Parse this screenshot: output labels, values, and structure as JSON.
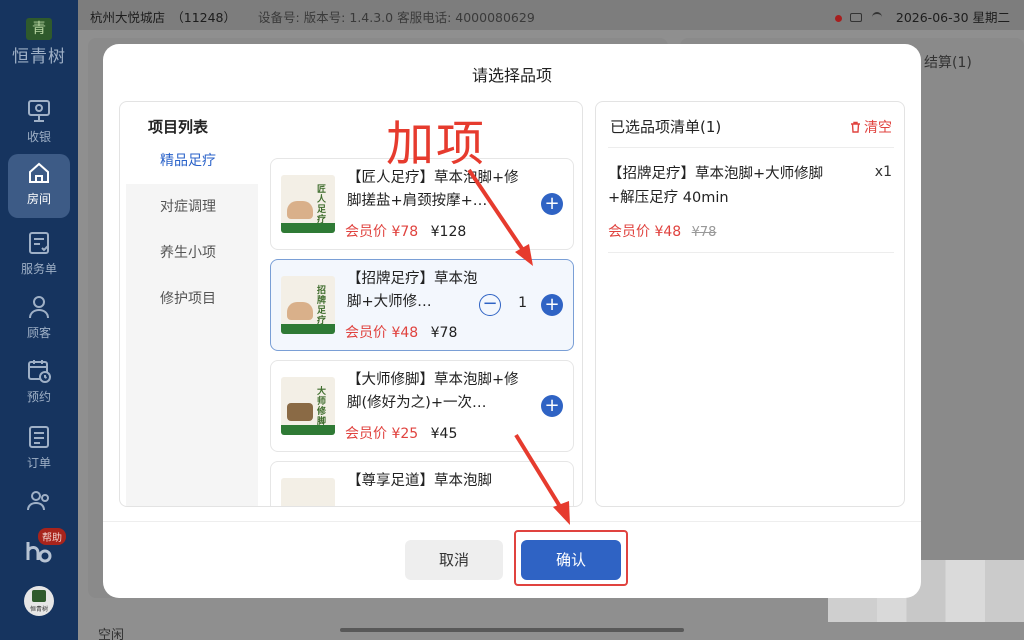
{
  "app": {
    "brand_glyph": "青",
    "brand_name": "恒青树",
    "nav": [
      {
        "label": "收银",
        "icon": "cashier-monitor-icon"
      },
      {
        "label": "房间",
        "icon": "home-icon"
      },
      {
        "label": "服务单",
        "icon": "service-order-icon"
      },
      {
        "label": "顾客",
        "icon": "customer-icon"
      },
      {
        "label": "预约",
        "icon": "calendar-clock-icon"
      },
      {
        "label": "订单",
        "icon": "order-list-icon"
      }
    ],
    "helper_badge": "帮助",
    "mini_logo": "恒青树"
  },
  "topbar": {
    "store": "杭州大悦城店　（11248）",
    "device": "设备号:  版本号: 1.4.3.0  客服电话: 4000080629",
    "datetime": "2026-06-30 星期二"
  },
  "background": {
    "checkout_tab": "结算(1)",
    "status_idle": "空闲"
  },
  "modal": {
    "title": "请选择品项",
    "project_list_title": "项目列表",
    "categories": [
      "精品足疗",
      "对症调理",
      "养生小项",
      "修护项目"
    ],
    "items": [
      {
        "name": "【匠人足疗】草本泡脚+修脚搓盐+肩颈按摩+…",
        "member_label": "会员价",
        "member_price": "¥78",
        "price": "¥128",
        "thumb_text": "匠人足疗"
      },
      {
        "name": "【招牌足疗】草本泡脚+大师修…",
        "member_label": "会员价",
        "member_price": "¥48",
        "price": "¥78",
        "thumb_text": "招牌足疗",
        "qty": "1",
        "selected": true
      },
      {
        "name": "【大师修脚】草本泡脚+修脚(修好为之)+一次…",
        "member_label": "会员价",
        "member_price": "¥25",
        "price": "¥45",
        "thumb_text": "大师修脚"
      },
      {
        "name": "【尊享足道】草本泡脚",
        "member_label": "",
        "member_price": "",
        "price": "",
        "thumb_text": ""
      }
    ],
    "selected_list_title": "已选品项清单(1)",
    "clear_label": "清空",
    "selected": [
      {
        "name": "【招牌足疗】草本泡脚+大师修脚+解压足疗 40min",
        "qty": "x1",
        "member_label": "会员价",
        "member_price": "¥48",
        "orig_price": "¥78"
      }
    ],
    "cancel_label": "取消",
    "confirm_label": "确认"
  },
  "annotation": {
    "text": "加项",
    "color": "#e63b2e"
  },
  "colors": {
    "primary": "#2f63c4",
    "member_price": "#e0433f",
    "sidebar": "#16345f"
  }
}
